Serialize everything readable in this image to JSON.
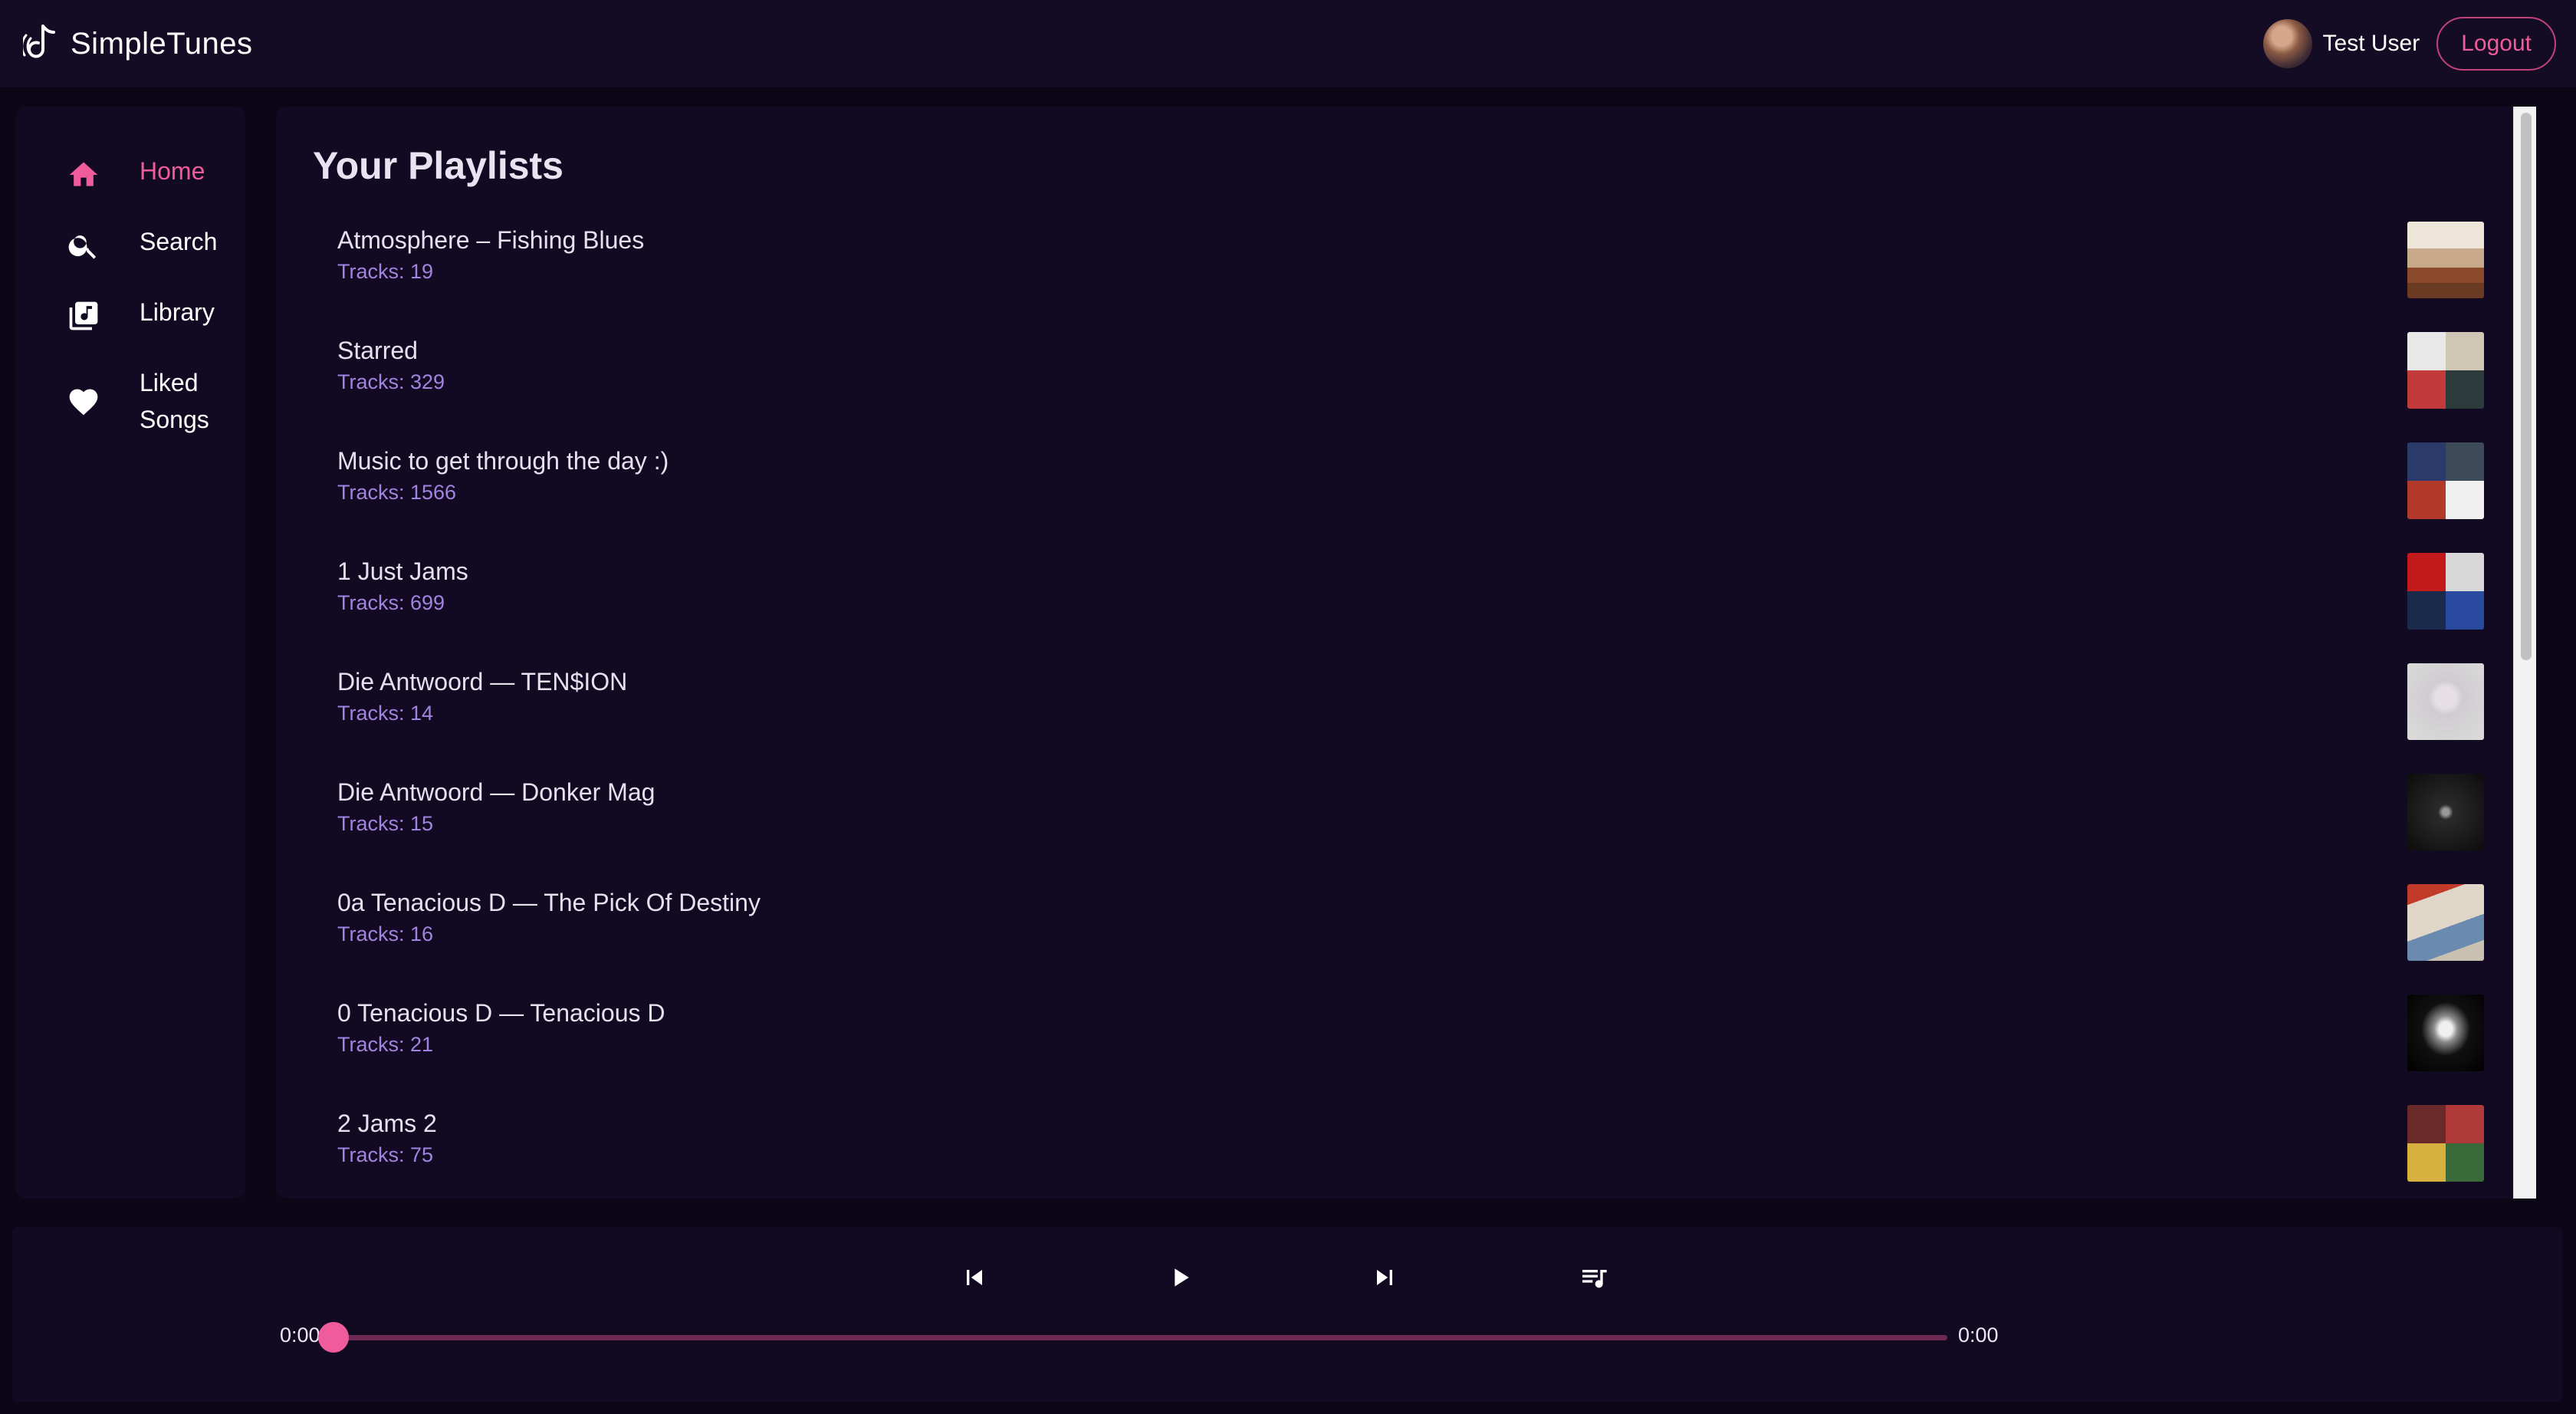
{
  "app": {
    "name": "SimpleTunes"
  },
  "header": {
    "username": "Test User",
    "logout_label": "Logout"
  },
  "sidebar": {
    "items": [
      {
        "label": "Home",
        "icon": "home-icon",
        "active": true
      },
      {
        "label": "Search",
        "icon": "search-icon",
        "active": false
      },
      {
        "label": "Library",
        "icon": "library-music-icon",
        "active": false
      },
      {
        "label": "Liked Songs",
        "icon": "heart-icon",
        "active": false
      }
    ]
  },
  "main": {
    "title": "Your Playlists",
    "playlists": [
      {
        "name": "Atmosphere – Fishing Blues",
        "tracks": "Tracks: 19"
      },
      {
        "name": "Starred",
        "tracks": "Tracks: 329"
      },
      {
        "name": "Music to get through the day :)",
        "tracks": "Tracks: 1566"
      },
      {
        "name": "1 Just Jams",
        "tracks": "Tracks: 699"
      },
      {
        "name": "Die Antwoord — TEN$ION",
        "tracks": "Tracks: 14"
      },
      {
        "name": "Die Antwoord — Donker Mag",
        "tracks": "Tracks: 15"
      },
      {
        "name": "0a Tenacious D — The Pick Of Destiny",
        "tracks": "Tracks: 16"
      },
      {
        "name": "0 Tenacious D — Tenacious D",
        "tracks": "Tracks: 21"
      },
      {
        "name": "2 Jams 2",
        "tracks": "Tracks: 75"
      }
    ]
  },
  "player": {
    "elapsed": "0:00",
    "duration": "0:00",
    "progress": 0,
    "controls": [
      "skip-previous-icon",
      "play-icon",
      "skip-next-icon",
      "queue-music-icon"
    ]
  },
  "colors": {
    "accent": "#ef5b9b",
    "background": "#0c0716",
    "panel": "#120a22",
    "subtext": "#a183e0"
  }
}
